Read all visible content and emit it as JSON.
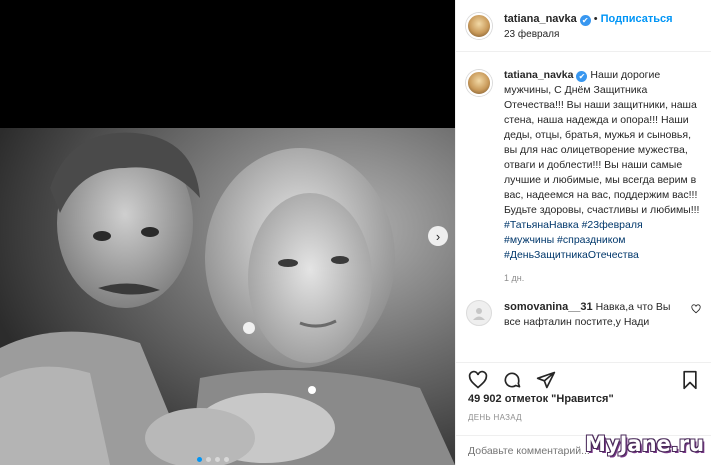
{
  "post": {
    "username": "tatiana_navka",
    "verified_badge": "✔",
    "follow_separator": "•",
    "follow_label": "Подписаться",
    "date": "23 февраля",
    "caption": "Наши дорогие мужчины, С Днём Защитника Отечества!!! Вы наши защитники, наша стена, наша надежда и опора!!! Наши деды, отцы, братья, мужья и сыновья, вы для нас олицетворение мужества, отваги и доблести!!! Вы наши самые лучшие и любимые, мы всегда верим в вас, надеемся на вас, поддержим вас!!! Будьте здоровы, счастливы и любимы!!!",
    "hashtags": [
      "#ТатьянаНавка #23февраля",
      "#мужчины #спраздником",
      "#ДеньЗащитникаОтечества"
    ],
    "age": "1 дн.",
    "comment": {
      "username": "somovanina__31",
      "text": "Навка,а что Вы все нафталин постите,у Нади"
    },
    "likes": "49 902 отметок \"Нравится\"",
    "time_ago": "ДЕНЬ НАЗАД",
    "add_comment_placeholder": "Добавьте комментарий..."
  },
  "media": {
    "slide_count": 4,
    "active_slide": 1,
    "next_arrow": "›"
  },
  "icons": {
    "like": "heart-icon",
    "comment": "comment-icon",
    "share": "share-icon",
    "save": "bookmark-icon"
  },
  "colors": {
    "accent": "#0095f6",
    "link": "#00376b",
    "verified": "#3897f0"
  },
  "watermark": "MyJane.ru"
}
